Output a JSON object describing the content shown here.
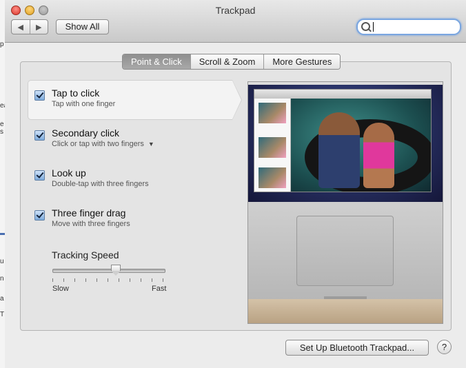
{
  "window": {
    "title": "Trackpad"
  },
  "toolbar": {
    "back_glyph": "◀",
    "forward_glyph": "▶",
    "show_all": "Show All"
  },
  "search": {
    "value": "",
    "placeholder": ""
  },
  "tabs": [
    {
      "label": "Point & Click",
      "active": true
    },
    {
      "label": "Scroll & Zoom",
      "active": false
    },
    {
      "label": "More Gestures",
      "active": false
    }
  ],
  "options": [
    {
      "title": "Tap to click",
      "subtitle": "Tap with one finger",
      "checked": true
    },
    {
      "title": "Secondary click",
      "subtitle": "Click or tap with two fingers",
      "checked": true,
      "has_dropdown": true
    },
    {
      "title": "Look up",
      "subtitle": "Double-tap with three fingers",
      "checked": true
    },
    {
      "title": "Three finger drag",
      "subtitle": "Move with three fingers",
      "checked": true
    }
  ],
  "tracking": {
    "label": "Tracking Speed",
    "min_label": "Slow",
    "max_label": "Fast",
    "value_fraction": 0.56
  },
  "footer": {
    "bluetooth_button": "Set Up Bluetooth Trackpad...",
    "help": "?"
  },
  "background_fragments": [
    "p",
    "ea",
    "e",
    "s",
    "u",
    "n",
    "a",
    "T"
  ],
  "icons": [
    "back-arrow-icon",
    "forward-arrow-icon",
    "search-icon",
    "checkbox-icon",
    "dropdown-arrow-icon",
    "help-icon"
  ],
  "colors": {
    "accent": "#7aa6e0",
    "close": "#d9362b",
    "minimize": "#dfa023"
  }
}
